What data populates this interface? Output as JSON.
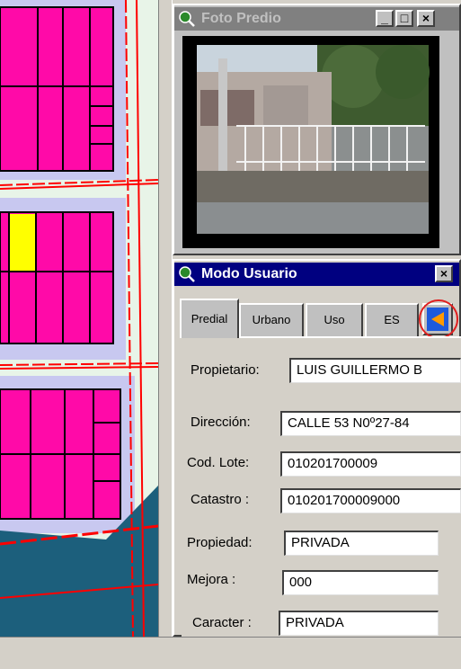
{
  "photo_window": {
    "title": "Foto Predio",
    "minimize_label": "_",
    "maximize_label": "□",
    "close_label": "×"
  },
  "user_window": {
    "title": "Modo Usuario",
    "close_label": "×",
    "tabs": [
      {
        "label": "Predial",
        "active": true
      },
      {
        "label": "Urbano",
        "active": false
      },
      {
        "label": "Uso",
        "active": false
      },
      {
        "label": "ES",
        "active": false
      }
    ],
    "fields": {
      "propietario": {
        "label": "Propietario:",
        "value": "LUIS GUILLERMO B"
      },
      "direccion": {
        "label": "Dirección:",
        "value": "CALLE 53  N0º27-84"
      },
      "cod_lote": {
        "label": "Cod. Lote:",
        "value": "010201700009"
      },
      "catastro": {
        "label": "Catastro  :",
        "value": "010201700009000"
      },
      "propiedad": {
        "label": "Propiedad:",
        "value": "PRIVADA"
      },
      "mejora": {
        "label": "Mejora     :",
        "value": "000"
      },
      "caracter": {
        "label": "Caracter :",
        "value": "PRIVADA"
      }
    }
  },
  "map": {
    "parcel_color": "#ff0aa8",
    "selected_parcel_color": "#ffff00",
    "road_color": "#ff0000",
    "water_color": "#1c5f7c",
    "background_color": "#e8f4e8"
  },
  "icons": {
    "window_icon": "globe-magnifier-icon",
    "nav_button_icon": "triangle-left-icon"
  }
}
